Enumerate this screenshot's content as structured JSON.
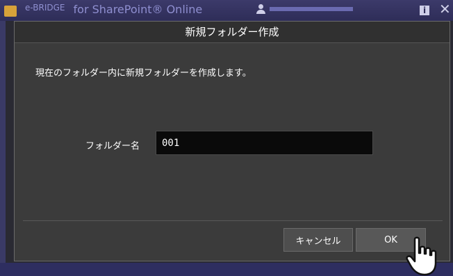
{
  "app": {
    "title_small": "e-BRIDGE",
    "title": "for SharePoint® Online",
    "info_glyph": "i",
    "close_glyph": "✕",
    "colors": {
      "accent": "#2e2d58",
      "dialog_bg": "#3b3b3b",
      "input_bg": "#0a0a0a"
    }
  },
  "dialog": {
    "title": "新規フォルダー作成",
    "message": "現在のフォルダー内に新規フォルダーを作成します。",
    "folder_name_label": "フォルダー名",
    "folder_name_value": "001",
    "cancel_label": "キャンセル",
    "ok_label": "OK"
  },
  "icons": [
    "app-logo-icon",
    "user-icon",
    "info-icon",
    "close-icon",
    "hand-cursor-icon"
  ]
}
